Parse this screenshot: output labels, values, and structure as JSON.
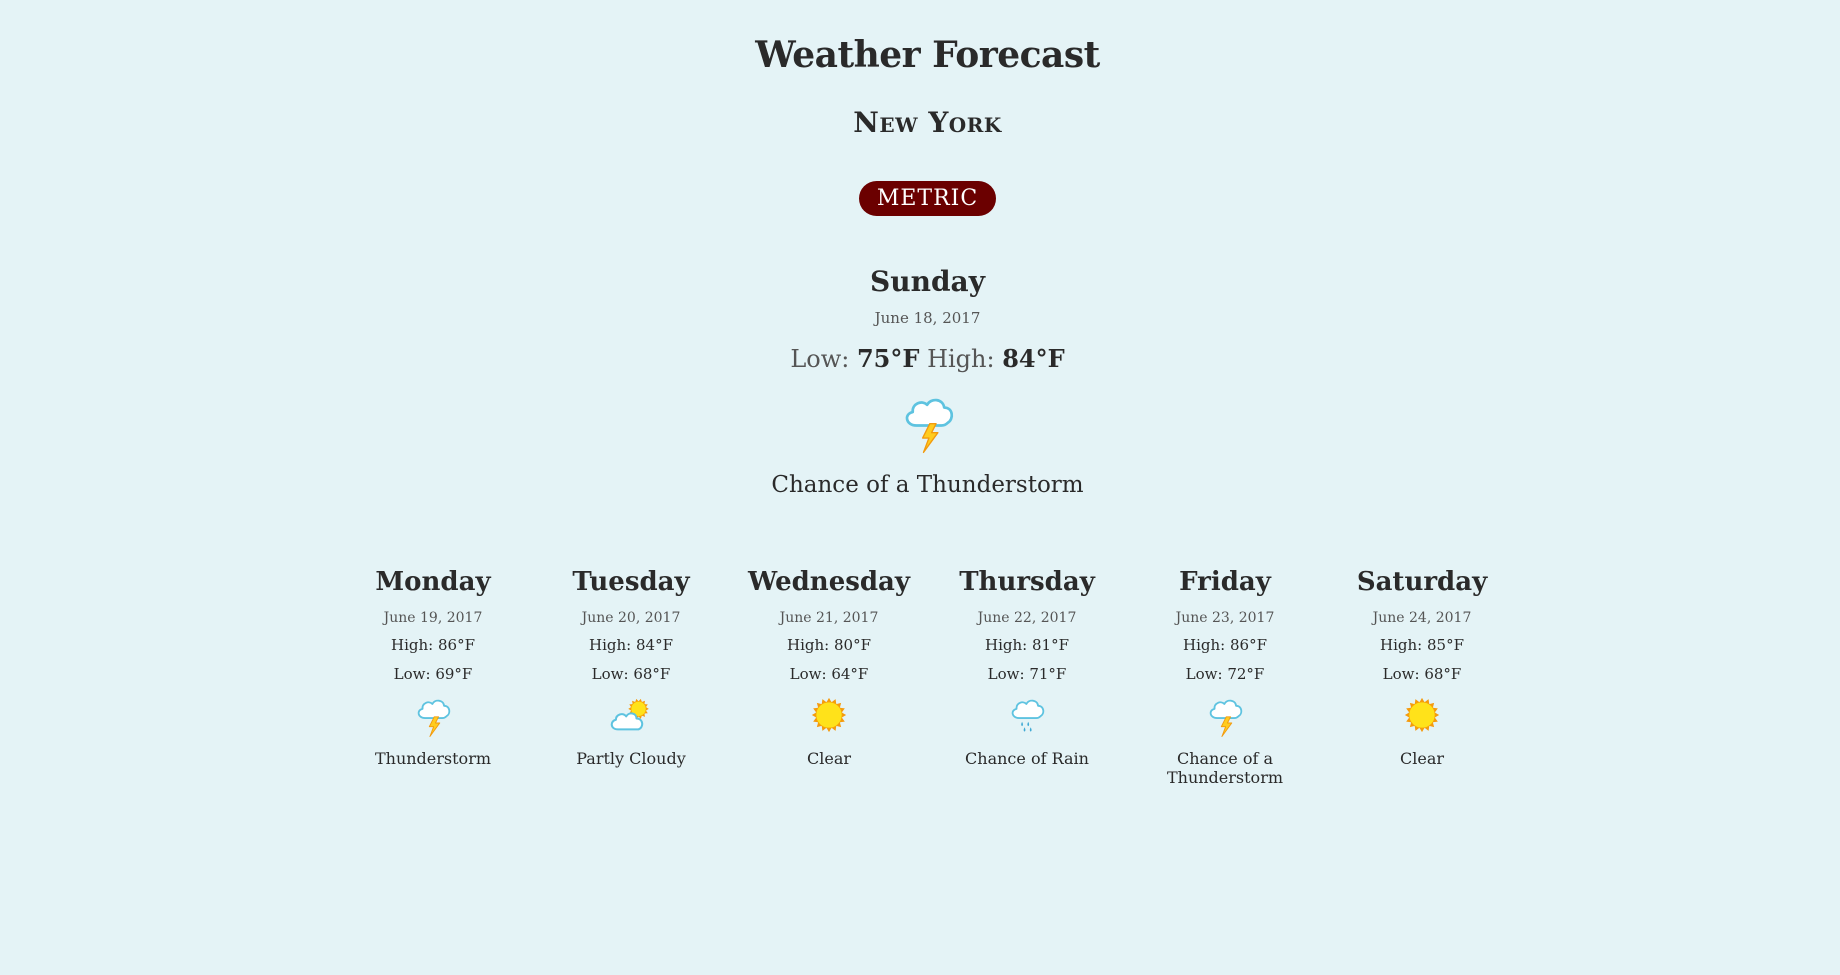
{
  "header": {
    "title": "Weather Forecast",
    "city": "New York",
    "unit_toggle_label": "METRIC"
  },
  "today": {
    "day": "Sunday",
    "date": "June 18, 2017",
    "low_label": "Low:",
    "low": "75°F",
    "high_label": "High:",
    "high": "84°F",
    "icon": "thunderstorm-icon",
    "condition": "Chance of a Thunderstorm"
  },
  "forecast": [
    {
      "day": "Monday",
      "date": "June 19, 2017",
      "high": "High: 86°F",
      "low": "Low: 69°F",
      "icon": "thunderstorm-icon",
      "condition": "Thunderstorm"
    },
    {
      "day": "Tuesday",
      "date": "June 20, 2017",
      "high": "High: 84°F",
      "low": "Low: 68°F",
      "icon": "partly-cloudy-icon",
      "condition": "Partly Cloudy"
    },
    {
      "day": "Wednesday",
      "date": "June 21, 2017",
      "high": "High: 80°F",
      "low": "Low: 64°F",
      "icon": "sun-icon",
      "condition": "Clear"
    },
    {
      "day": "Thursday",
      "date": "June 22, 2017",
      "high": "High: 81°F",
      "low": "Low: 71°F",
      "icon": "rain-icon",
      "condition": "Chance of Rain"
    },
    {
      "day": "Friday",
      "date": "June 23, 2017",
      "high": "High: 86°F",
      "low": "Low: 72°F",
      "icon": "thunderstorm-icon",
      "condition": "Chance of a Thunderstorm"
    },
    {
      "day": "Saturday",
      "date": "June 24, 2017",
      "high": "High: 85°F",
      "low": "Low: 68°F",
      "icon": "sun-icon",
      "condition": "Clear"
    }
  ],
  "colors": {
    "background": "#e4f3f6",
    "accent": "#6b0000",
    "text": "#2a2a2a",
    "muted_text": "#555555"
  }
}
